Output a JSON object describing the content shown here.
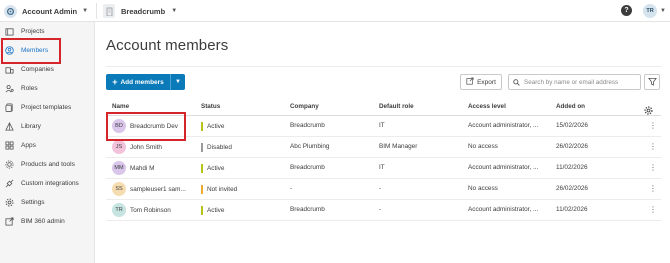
{
  "topbar": {
    "account_label": "Account Admin",
    "breadcrumb_label": "Breadcrumb",
    "help_label": "?",
    "user_initials": "TR"
  },
  "sidebar": {
    "items": [
      {
        "label": "Projects",
        "icon": "projects-icon"
      },
      {
        "label": "Members",
        "icon": "members-icon",
        "active": true
      },
      {
        "label": "Companies",
        "icon": "companies-icon"
      },
      {
        "label": "Roles",
        "icon": "roles-icon"
      },
      {
        "label": "Project templates",
        "icon": "project-templates-icon"
      },
      {
        "label": "Library",
        "icon": "library-icon"
      },
      {
        "label": "Apps",
        "icon": "apps-icon"
      },
      {
        "label": "Products and tools",
        "icon": "products-tools-icon"
      },
      {
        "label": "Custom integrations",
        "icon": "custom-integrations-icon"
      },
      {
        "label": "Settings",
        "icon": "settings-icon"
      },
      {
        "label": "BIM 360 admin",
        "icon": "external-link-icon"
      }
    ]
  },
  "main": {
    "title": "Account members",
    "add_members_label": "Add members",
    "export_label": "Export",
    "search_placeholder": "Search by name or email address"
  },
  "table": {
    "columns": [
      "Name",
      "Status",
      "Company",
      "Default role",
      "Access level",
      "Added on"
    ],
    "rows": [
      {
        "initials": "BD",
        "avatar_color": "#d9c6ea",
        "name": "Breadcrumb Dev",
        "status": "Active",
        "status_color": "#b8c31a",
        "company": "Breadcrumb",
        "role": "IT",
        "access": "Account administrator, ...",
        "added": "15/02/2026"
      },
      {
        "initials": "JS",
        "avatar_color": "#f3c3dc",
        "name": "John Smith",
        "status": "Disabled",
        "status_color": "#9a9a9a",
        "company": "Abc Plumbing",
        "role": "BIM Manager",
        "access": "No access",
        "added": "26/02/2026"
      },
      {
        "initials": "MM",
        "avatar_color": "#d9c6ea",
        "name": "Mahdi M",
        "status": "Active",
        "status_color": "#b8c31a",
        "company": "Breadcrumb",
        "role": "IT",
        "access": "Account administrator, ...",
        "added": "11/02/2026"
      },
      {
        "initials": "SS",
        "avatar_color": "#f6dcb1",
        "name": "sampleuser1 sam...",
        "status": "Not invited",
        "status_color": "#f0a92b",
        "company": "-",
        "role": "-",
        "access": "No access",
        "added": "26/02/2026"
      },
      {
        "initials": "TR",
        "avatar_color": "#c6e4e1",
        "name": "Tom Robinson",
        "status": "Active",
        "status_color": "#b8c31a",
        "company": "Breadcrumb",
        "role": "-",
        "access": "Account administrator, ...",
        "added": "11/02/2026"
      }
    ]
  },
  "colors": {
    "accent": "#0a7ab9",
    "highlight": "#d6252a",
    "active_nav": "#1a73c6"
  }
}
